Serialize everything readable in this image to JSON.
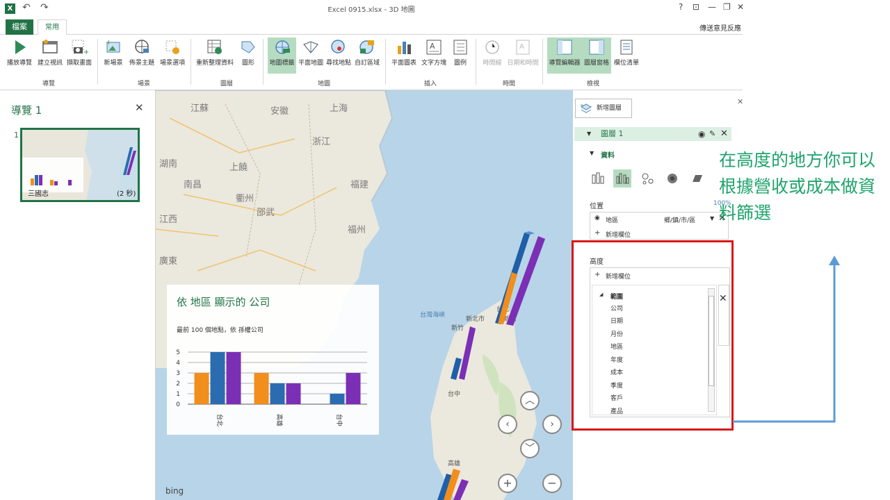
{
  "window": {
    "title": "Excel 0915.xlsx - 3D 地圖",
    "controls": [
      "?",
      "⊡",
      "—",
      "❐",
      "✕"
    ]
  },
  "tabs": {
    "file": "檔案",
    "home": "常用",
    "feedback": "傳送意見反應"
  },
  "ribbon": {
    "buttons": [
      {
        "label": "播放導覽",
        "icon": "play-icon"
      },
      {
        "label": "建立視訊",
        "icon": "video-icon"
      },
      {
        "label": "擷取畫面",
        "icon": "camera-icon"
      },
      {
        "label": "新場景",
        "icon": "new-scene-icon"
      },
      {
        "label": "佈景主題",
        "icon": "theme-icon"
      },
      {
        "label": "場景選項",
        "icon": "scene-options-icon"
      },
      {
        "label": "重新整理資料",
        "icon": "refresh-icon"
      },
      {
        "label": "圖形",
        "icon": "shapes-icon"
      },
      {
        "label": "地圖標籤",
        "icon": "map-labels-icon"
      },
      {
        "label": "平面地圖",
        "icon": "flat-map-icon"
      },
      {
        "label": "尋找地點",
        "icon": "find-location-icon"
      },
      {
        "label": "自訂區域",
        "icon": "custom-regions-icon"
      },
      {
        "label": "平面圖表",
        "icon": "2d-chart-icon"
      },
      {
        "label": "文字方塊",
        "icon": "text-box-icon"
      },
      {
        "label": "圖例",
        "icon": "legend-icon"
      },
      {
        "label": "時間線",
        "icon": "timeline-icon"
      },
      {
        "label": "日期和時間",
        "icon": "date-time-icon"
      },
      {
        "label": "導覽編輯器",
        "icon": "tour-editor-icon"
      },
      {
        "label": "圖層窗格",
        "icon": "layer-pane-icon"
      },
      {
        "label": "欄位清單",
        "icon": "field-list-icon"
      }
    ],
    "groups": [
      "導覽",
      "場景",
      "圖層",
      "地圖",
      "插入",
      "時間",
      "檢視"
    ]
  },
  "tour": {
    "title": "導覽 1",
    "scene_number": "1",
    "scene_name": "三國志",
    "scene_duration": "(2 秒)"
  },
  "map": {
    "labels": [
      "江蘇",
      "安徽",
      "上海",
      "浙江",
      "江西",
      "福建",
      "廣東",
      "湖南",
      "衢州",
      "福州",
      "上饒",
      "南昌",
      "台灣海峽",
      "台北",
      "新北市",
      "新竹",
      "台中",
      "高雄",
      "新北",
      "邵武"
    ],
    "brand": "bing"
  },
  "card": {
    "title": "依 地區 顯示的 公司",
    "subtitle": "最前 100 個地點，依 孫權公司"
  },
  "chart_data": {
    "type": "bar",
    "categories": [
      "台北",
      "高雄",
      "台中"
    ],
    "series": [
      {
        "values": [
          3,
          3,
          0
        ],
        "color": "#f28e1c"
      },
      {
        "values": [
          5,
          2,
          1
        ],
        "color": "#2b6cb0"
      },
      {
        "values": [
          5,
          2,
          3
        ],
        "color": "#7b2fb5"
      }
    ],
    "ylim": [
      0,
      5
    ],
    "yticks": [
      "0",
      "1",
      "2",
      "3",
      "4",
      "5"
    ],
    "grid": true
  },
  "pane": {
    "add_layer": "新增圖層",
    "layer_name": "圖層 1",
    "data_header": "資料",
    "location_label": "位置",
    "location_pct": "100%",
    "location_field": "地區",
    "location_type": "鄉/鎮/市/區",
    "add_field": "新增欄位",
    "height_label": "高度",
    "height_add_field": "新增欄位",
    "tree_root": "範圍",
    "fields": [
      "公司",
      "日期",
      "月份",
      "地區",
      "年度",
      "成本",
      "季度",
      "客戶",
      "產品"
    ]
  },
  "annotation": "在高度的地方你可以根據營收或成本做資料篩選",
  "colors": {
    "accent": "#217346",
    "red_box": "#d81818",
    "annotation": "#1fa46c",
    "arrow": "#5b9bd5"
  }
}
